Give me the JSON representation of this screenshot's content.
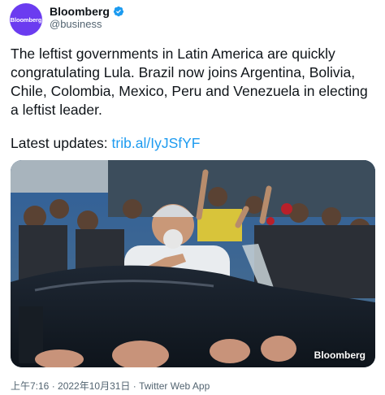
{
  "author": {
    "avatar_text": "Bloomberg",
    "display_name": "Bloomberg",
    "handle": "@business",
    "verified": true
  },
  "tweet": {
    "text": "The leftist governments in Latin America are quickly congratulating Lula. Brazil now joins Argentina, Bolivia, Chile, Colombia, Mexico, Peru and Venezuela in electing a leftist leader.",
    "updates_label": "Latest updates: ",
    "link_text": "trib.al/IyJSfYF"
  },
  "media": {
    "watermark": "Bloomberg",
    "icon": "crowd-photo"
  },
  "meta": {
    "timestamp": "上午7:16 · 2022年10月31日",
    "separator": " · ",
    "source": "Twitter Web App"
  },
  "colors": {
    "link": "#1d9bf0",
    "verified": "#1d9bf0",
    "avatar_bg": "#6b3cf0",
    "secondary_text": "#536471"
  }
}
